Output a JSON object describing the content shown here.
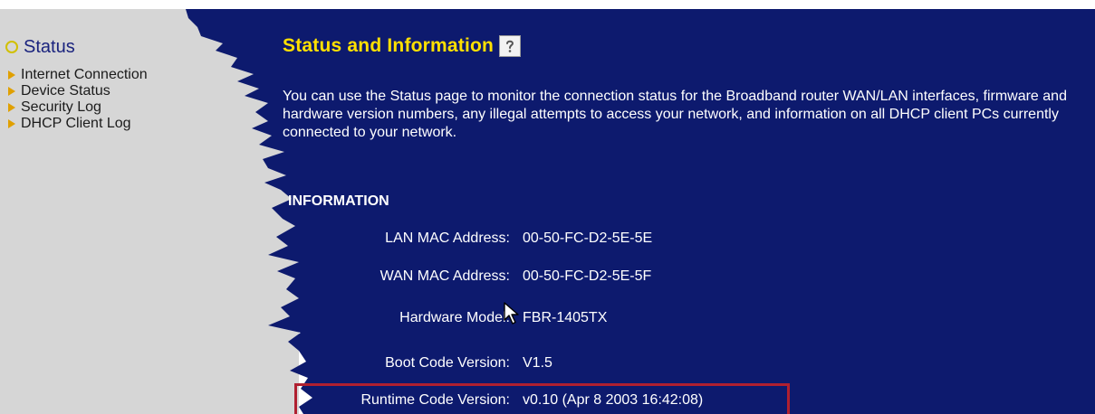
{
  "sidebar": {
    "status_label": "Status",
    "items": [
      {
        "label": "Internet Connection"
      },
      {
        "label": "Device Status"
      },
      {
        "label": "Security Log"
      },
      {
        "label": "DHCP Client Log"
      }
    ]
  },
  "header": {
    "title": "Status and Information"
  },
  "intro": {
    "text": "You can use the Status page to monitor the connection status for the Broadband router WAN/LAN interfaces, firmware and hardware version numbers, any illegal attempts to access your network, and information on all DHCP client PCs currently connected to your network."
  },
  "information": {
    "heading": "INFORMATION",
    "rows": [
      {
        "label": "LAN MAC Address:",
        "value": "00-50-FC-D2-5E-5E"
      },
      {
        "label": "WAN MAC Address:",
        "value": "00-50-FC-D2-5E-5F"
      },
      {
        "label": "Hardware Model:",
        "value": "FBR-1405TX"
      },
      {
        "label": "Boot Code Version:",
        "value": "V1.5"
      },
      {
        "label": "Runtime Code Version:",
        "value": "v0.10 (Apr 8 2003 16:42:08)"
      }
    ]
  },
  "colors": {
    "content_background": "#0d1a6e",
    "sidebar_background": "#d6d6d6",
    "title_color": "#ffe000",
    "highlight_border": "#b02030",
    "bullet_color": "#e0a000"
  },
  "icons": {
    "status_bullet": "ring-icon",
    "menu_bullet": "triangle-right-icon",
    "help": "help-icon"
  }
}
